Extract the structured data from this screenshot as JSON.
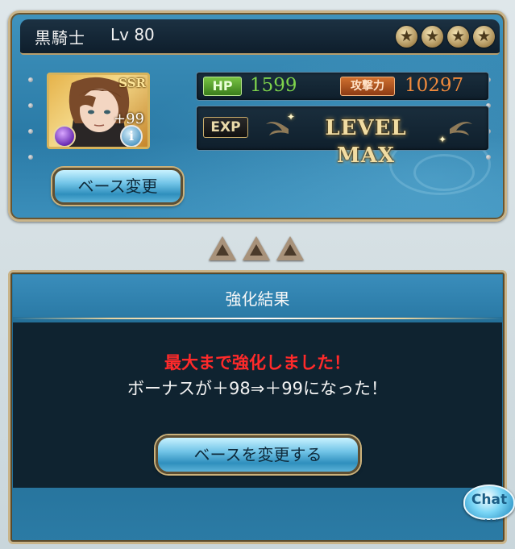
{
  "character": {
    "name": "黒騎士",
    "level_text": "Lv 80",
    "star_count": 4,
    "rarity": "SSR",
    "plus_bonus": "+99",
    "element_icon": "dark-element-icon",
    "hp_label": "HP",
    "hp_value": "1599",
    "attack_label": "攻撃力",
    "attack_value": "10297",
    "exp_label": "EXP",
    "exp_status": "LEVEL MAX"
  },
  "buttons": {
    "base_change": "ベース変更",
    "change_base_action": "ベースを変更する",
    "chat": "Chat"
  },
  "result": {
    "title": "強化結果",
    "message_max": "最大まで強化しました！",
    "message_bonus": "ボーナスが＋98⇒＋99になった！"
  },
  "colors": {
    "hp": "#7ed34c",
    "attack": "#f08a3c",
    "alert_text": "#ff2a2a"
  }
}
